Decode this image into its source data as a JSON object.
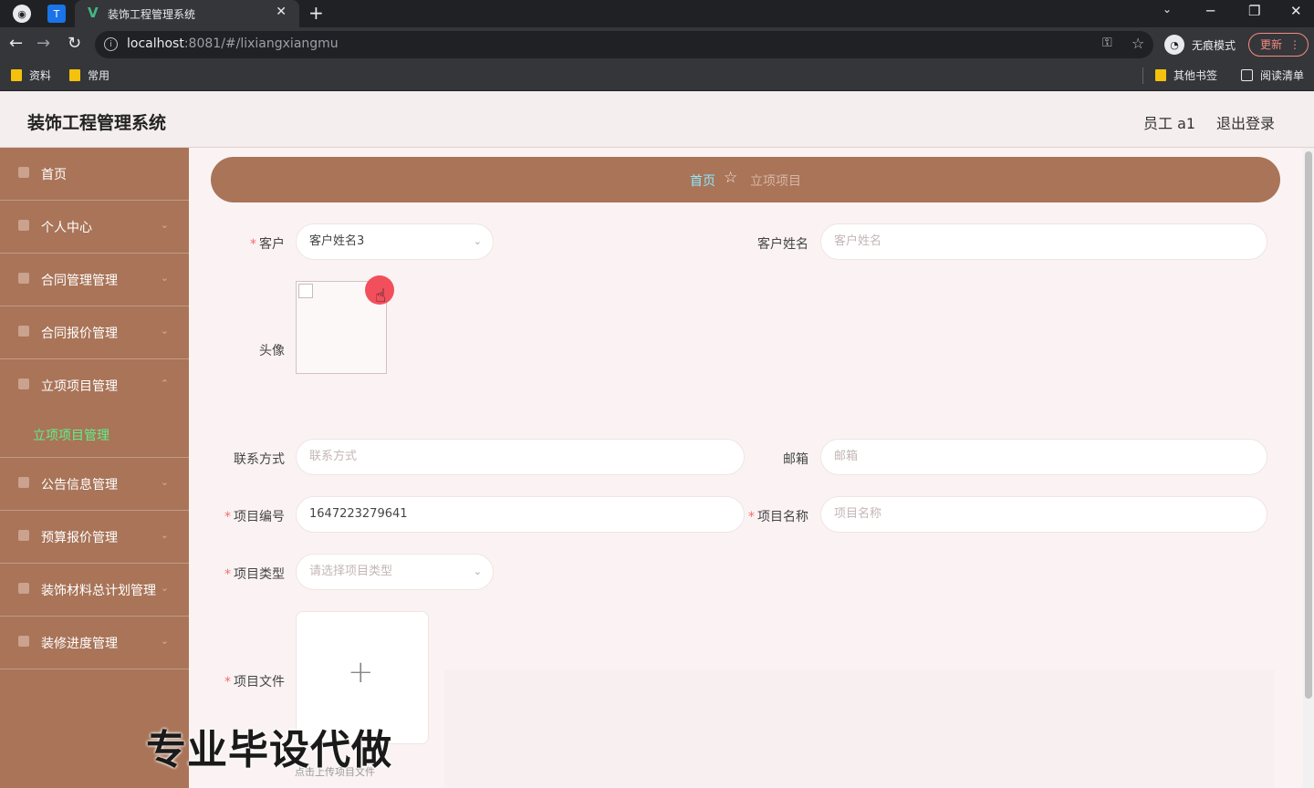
{
  "browser": {
    "tab_title": "装饰工程管理系统",
    "url_host": "localhost",
    "url_rest": ":8081/#/lixiangxiangmu",
    "incognito_label": "无痕模式",
    "update_label": "更新",
    "bookmarks": [
      "资料",
      "常用"
    ],
    "other_bookmarks": "其他书签",
    "reading_list": "阅读清单"
  },
  "header": {
    "title": "装饰工程管理系统",
    "user": "员工 a1",
    "logout": "退出登录"
  },
  "sidebar": {
    "items": [
      "首页",
      "个人中心",
      "合同管理管理",
      "合同报价管理",
      "立项项目管理",
      "公告信息管理",
      "预算报价管理",
      "装饰材料总计划管理",
      "装修进度管理"
    ],
    "active_sub": "立项项目管理"
  },
  "breadcrumb": {
    "home": "首页",
    "current": "立项项目"
  },
  "form": {
    "customer_label": "客户",
    "customer_value": "客户姓名3",
    "customer_name_label": "客户姓名",
    "customer_name_placeholder": "客户姓名",
    "avatar_label": "头像",
    "contact_label": "联系方式",
    "contact_placeholder": "联系方式",
    "email_label": "邮箱",
    "email_placeholder": "邮箱",
    "project_no_label": "项目编号",
    "project_no_value": "1647223279641",
    "project_name_label": "项目名称",
    "project_name_placeholder": "项目名称",
    "project_type_label": "项目类型",
    "project_type_placeholder": "请选择项目类型",
    "project_file_label": "项目文件",
    "upload_hint": "点击上传项目文件"
  },
  "watermark": "专业毕设代做"
}
